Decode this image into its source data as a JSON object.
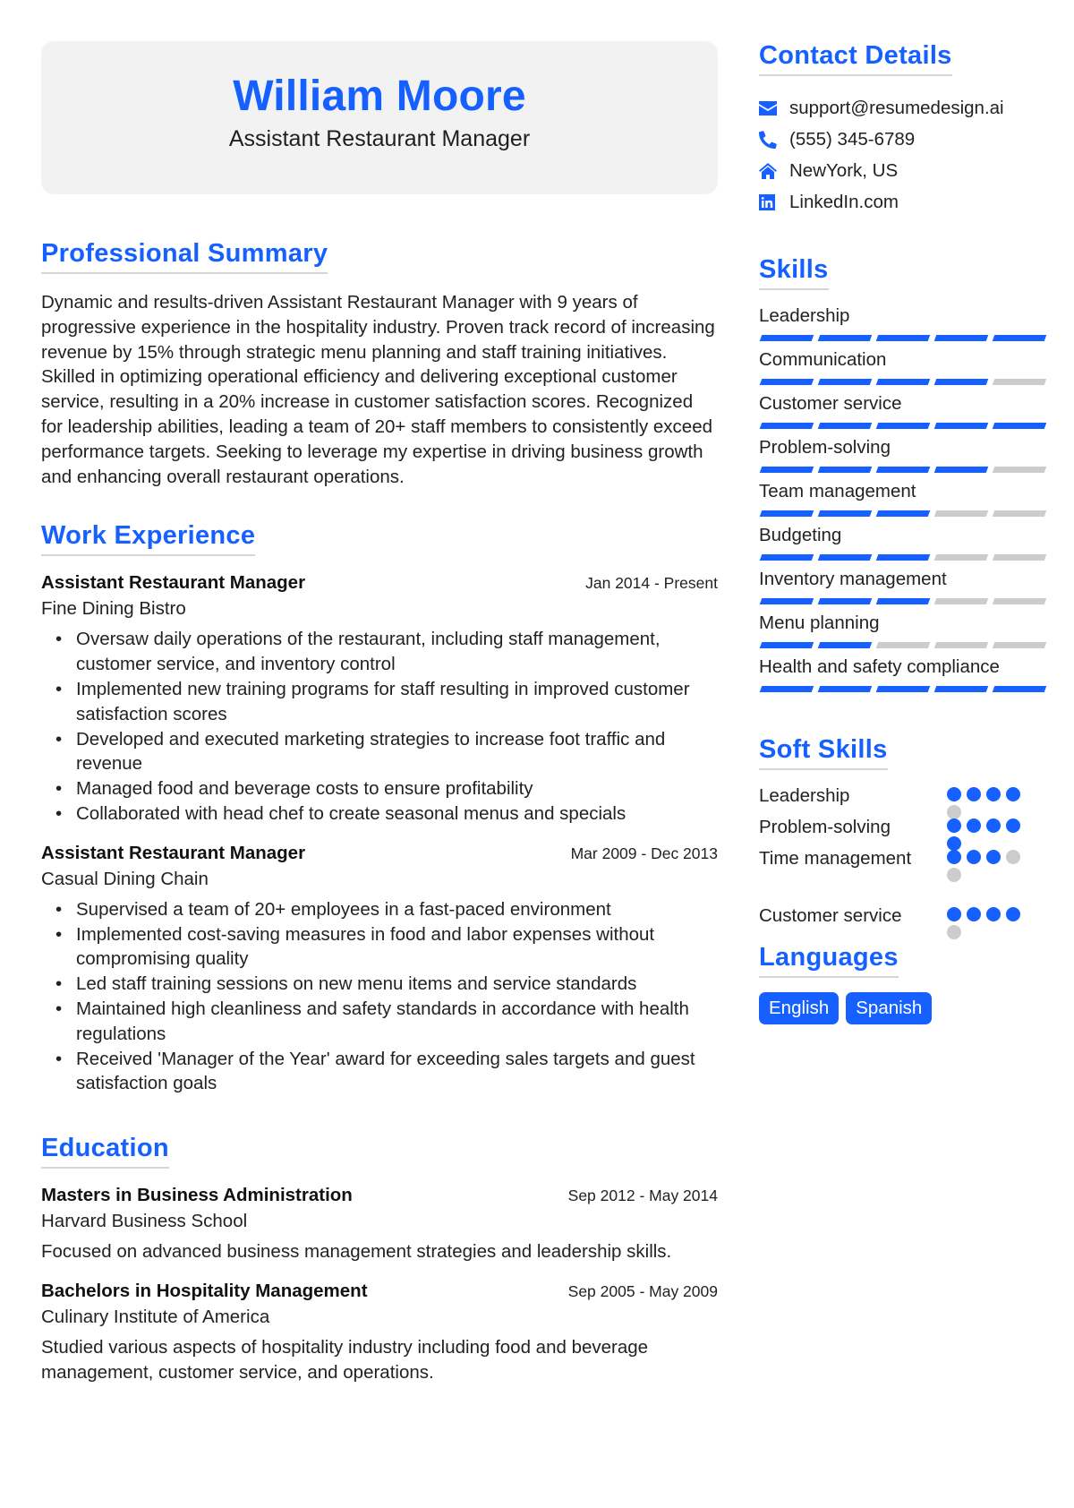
{
  "header": {
    "name": "William Moore",
    "role": "Assistant Restaurant Manager"
  },
  "summary": {
    "title": "Professional Summary",
    "text": "Dynamic and results-driven Assistant Restaurant Manager with 9 years of progressive experience in the hospitality industry. Proven track record of increasing revenue by 15% through strategic menu planning and staff training initiatives. Skilled in optimizing operational efficiency and delivering exceptional customer service, resulting in a 20% increase in customer satisfaction scores. Recognized for leadership abilities, leading a team of 20+ staff members to consistently exceed performance targets. Seeking to leverage my expertise in driving business growth and enhancing overall restaurant operations."
  },
  "work": {
    "title": "Work Experience",
    "jobs": [
      {
        "title": "Assistant Restaurant Manager",
        "date": "Jan 2014 - Present",
        "company": "Fine Dining Bistro",
        "bullets": [
          "Oversaw daily operations of the restaurant, including staff management, customer service, and inventory control",
          "Implemented new training programs for staff resulting in improved customer satisfaction scores",
          "Developed and executed marketing strategies to increase foot traffic and revenue",
          "Managed food and beverage costs to ensure profitability",
          "Collaborated with head chef to create seasonal menus and specials"
        ]
      },
      {
        "title": "Assistant Restaurant Manager",
        "date": "Mar 2009 - Dec 2013",
        "company": "Casual Dining Chain",
        "bullets": [
          "Supervised a team of 20+ employees in a fast-paced environment",
          "Implemented cost-saving measures in food and labor expenses without compromising quality",
          "Led staff training sessions on new menu items and service standards",
          "Maintained high cleanliness and safety standards in accordance with health regulations",
          "Received 'Manager of the Year' award for exceeding sales targets and guest satisfaction goals"
        ]
      }
    ]
  },
  "education": {
    "title": "Education",
    "items": [
      {
        "degree": "Masters in Business Administration",
        "date": "Sep 2012 - May 2014",
        "school": "Harvard Business School",
        "description": "Focused on advanced business management strategies and leadership skills."
      },
      {
        "degree": "Bachelors in Hospitality Management",
        "date": "Sep 2005 - May 2009",
        "school": "Culinary Institute of America",
        "description": "Studied various aspects of hospitality industry including food and beverage management, customer service, and operations."
      }
    ]
  },
  "contact": {
    "title": "Contact Details",
    "items": [
      {
        "icon": "envelope-icon",
        "text": "support@resumedesign.ai"
      },
      {
        "icon": "phone-icon",
        "text": "(555) 345-6789"
      },
      {
        "icon": "home-icon",
        "text": "NewYork, US"
      },
      {
        "icon": "linkedin-icon",
        "text": "LinkedIn.com"
      }
    ]
  },
  "skills": {
    "title": "Skills",
    "max": 5,
    "items": [
      {
        "name": "Leadership",
        "level": 5
      },
      {
        "name": "Communication",
        "level": 4
      },
      {
        "name": "Customer service",
        "level": 5
      },
      {
        "name": "Problem-solving",
        "level": 4
      },
      {
        "name": "Team management",
        "level": 3
      },
      {
        "name": "Budgeting",
        "level": 3
      },
      {
        "name": "Inventory management",
        "level": 3
      },
      {
        "name": "Menu planning",
        "level": 2
      },
      {
        "name": "Health and safety compliance",
        "level": 5
      }
    ]
  },
  "soft_skills": {
    "title": "Soft Skills",
    "max": 5,
    "items": [
      {
        "name": "Leadership",
        "level": 4
      },
      {
        "name": "Problem-solving",
        "level": 5
      },
      {
        "name": "Time management",
        "level": 3
      },
      {
        "name": "Customer service",
        "level": 4
      }
    ]
  },
  "languages": {
    "title": "Languages",
    "items": [
      "English",
      "Spanish"
    ]
  },
  "colors": {
    "accent": "#1560ff",
    "inactive": "#cccccc",
    "header_bg": "#f2f2f2"
  }
}
